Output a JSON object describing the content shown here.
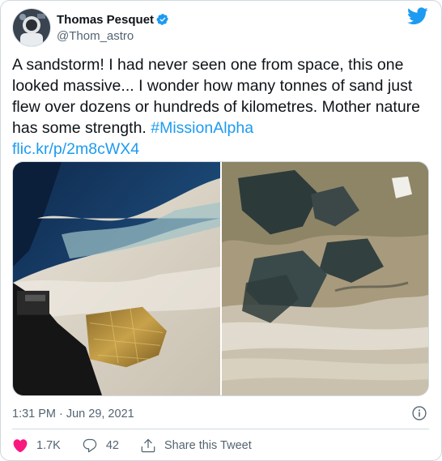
{
  "author": {
    "display_name": "Thomas Pesquet",
    "handle": "@Thom_astro",
    "verified": true
  },
  "tweet": {
    "text_before": "A sandstorm! I had never seen one from space, this one looked massive... I wonder how many tonnes of sand just flew over dozens or hundreds of kilometres. Mother nature has some strength. ",
    "hashtag": "#MissionAlpha",
    "link": "flic.kr/p/2m8cWX4"
  },
  "meta": {
    "time": "1:31 PM",
    "separator": "·",
    "date": "Jun 29, 2021"
  },
  "actions": {
    "likes": "1.7K",
    "replies": "42",
    "share_label": "Share this Tweet"
  },
  "colors": {
    "link": "#1d9bf0",
    "like_red": "#f91880",
    "muted": "#536471"
  },
  "icons": [
    "verified-badge-icon",
    "twitter-logo-icon",
    "info-icon",
    "heart-icon",
    "reply-icon",
    "share-icon"
  ]
}
